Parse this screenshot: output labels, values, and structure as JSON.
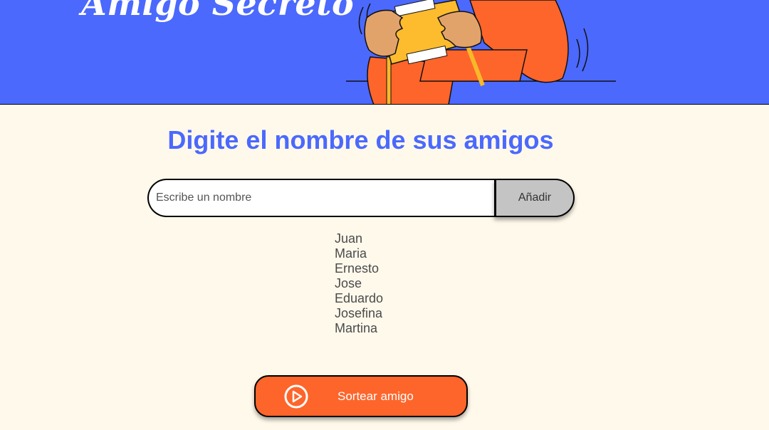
{
  "header": {
    "title": "Amigo Secreto",
    "background_color": "#4B69FD",
    "illustration_icon": "person-holding-gift-illustration"
  },
  "main": {
    "title": "Digite el nombre de sus amigos",
    "title_color": "#4B69FD",
    "input": {
      "placeholder": "Escribe un nombre",
      "value": ""
    },
    "add_button_label": "Añadir",
    "friends": [
      "Juan",
      "Maria",
      "Ernesto",
      "Jose",
      "Eduardo",
      "Josefina",
      "Martina"
    ],
    "draw_button": {
      "label": "Sortear amigo",
      "icon": "play-circle-icon",
      "color": "#FE652B"
    }
  }
}
